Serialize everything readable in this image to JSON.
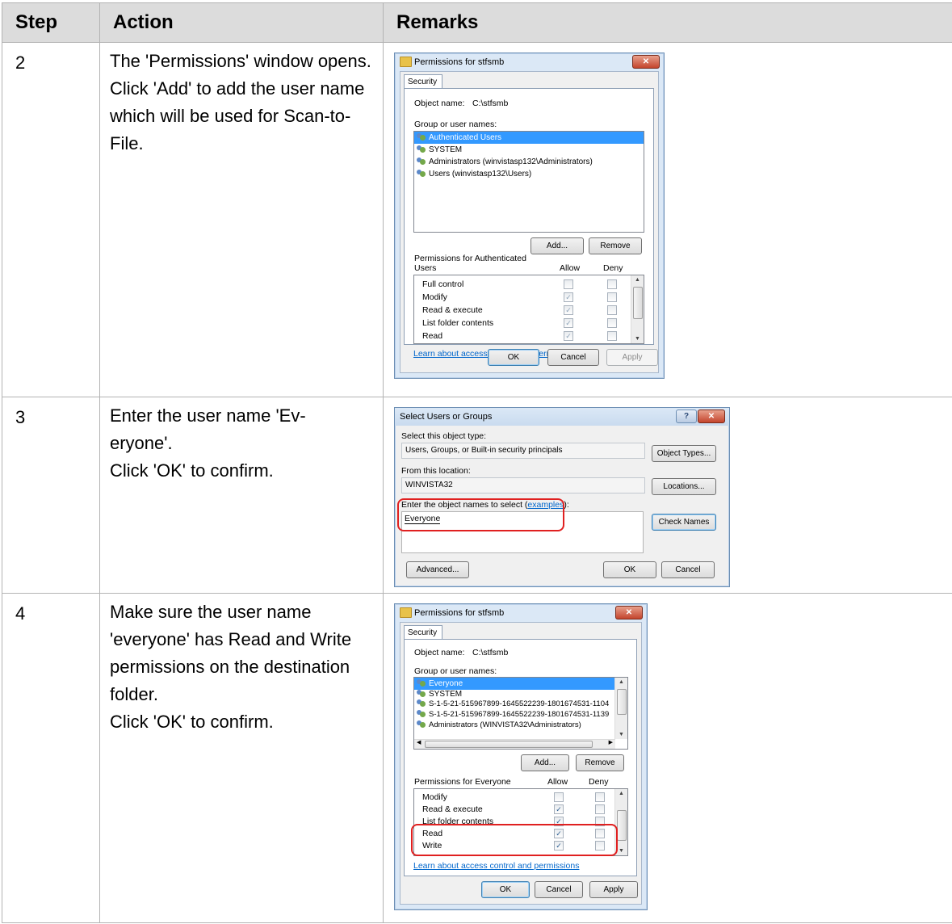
{
  "table": {
    "headers": {
      "step": "Step",
      "action": "Action",
      "remarks": "Remarks"
    },
    "rows": [
      {
        "step": "2",
        "action": "The 'Permissions' window opens.\nClick 'Add' to add the user name which will be used for Scan-to-File."
      },
      {
        "step": "3",
        "action": "Enter the user name 'Ev-\neryone'.\nClick 'OK' to confirm."
      },
      {
        "step": "4",
        "action": "Make sure the user name 'everyone' has Read and Write permissions on the destination folder.\nClick 'OK' to confirm."
      }
    ]
  },
  "dialog1": {
    "title": "Permissions for stfsmb",
    "tab": "Security",
    "object_name_label": "Object name:",
    "object_name_value": "C:\\stfsmb",
    "group_label": "Group or user names:",
    "users": [
      "Authenticated Users",
      "SYSTEM",
      "Administrators (winvistasp132\\Administrators)",
      "Users (winvistasp132\\Users)"
    ],
    "add_button": "Add...",
    "remove_button": "Remove",
    "perm_label_1": "Permissions for Authenticated",
    "perm_label_2": "Users",
    "allow_label": "Allow",
    "deny_label": "Deny",
    "permissions": [
      "Full control",
      "Modify",
      "Read & execute",
      "List folder contents",
      "Read"
    ],
    "link": "Learn about access control and permissions",
    "ok_button": "OK",
    "cancel_button": "Cancel",
    "apply_button": "Apply"
  },
  "dialog2": {
    "title": "Select Users or Groups",
    "help_button": "?",
    "object_type_label": "Select this object type:",
    "object_type_value": "Users, Groups, or Built-in security principals",
    "object_types_button": "Object Types...",
    "location_label": "From this location:",
    "location_value": "WINVISTA32",
    "locations_button": "Locations...",
    "enter_names_label": "Enter the object names to select (",
    "examples_link": "examples",
    "enter_names_end": "):",
    "names_value": "Everyone",
    "check_names_button": "Check Names",
    "advanced_button": "Advanced...",
    "ok_button": "OK",
    "cancel_button": "Cancel"
  },
  "dialog3": {
    "title": "Permissions for stfsmb",
    "tab": "Security",
    "object_name_label": "Object name:",
    "object_name_value": "C:\\stfsmb",
    "group_label": "Group or user names:",
    "users": [
      "Everyone",
      "SYSTEM",
      "S-1-5-21-515967899-1645522239-1801674531-1104",
      "S-1-5-21-515967899-1645522239-1801674531-1139",
      "Administrators (WINVISTA32\\Administrators)"
    ],
    "add_button": "Add...",
    "remove_button": "Remove",
    "perm_label": "Permissions for Everyone",
    "allow_label": "Allow",
    "deny_label": "Deny",
    "permissions": [
      "Modify",
      "Read & execute",
      "List folder contents",
      "Read",
      "Write"
    ],
    "link": "Learn about access control and permissions",
    "ok_button": "OK",
    "cancel_button": "Cancel",
    "apply_button": "Apply"
  },
  "colors": {
    "highlight": "#e02020",
    "selection": "#3399ff",
    "header_bg": "#dcdcdc"
  }
}
